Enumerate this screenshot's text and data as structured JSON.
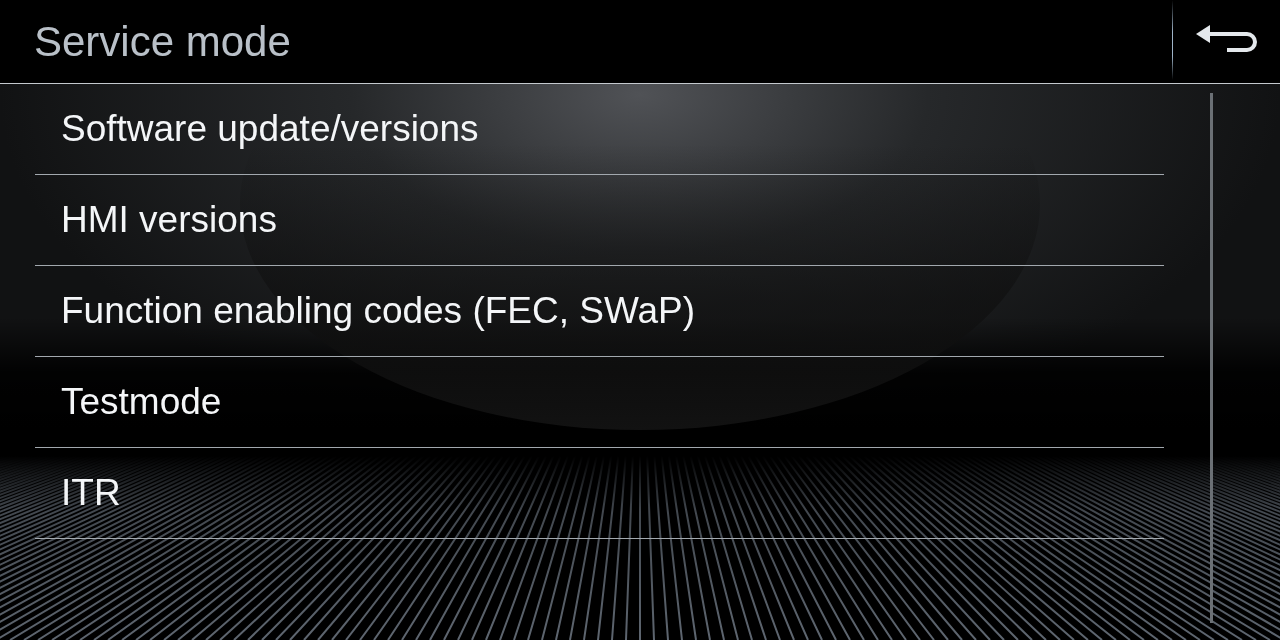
{
  "header": {
    "title": "Service mode"
  },
  "menu": [
    {
      "label": "Software update/versions"
    },
    {
      "label": "HMI versions"
    },
    {
      "label": "Function enabling codes (FEC, SWaP)"
    },
    {
      "label": "Testmode"
    },
    {
      "label": "ITR"
    }
  ]
}
